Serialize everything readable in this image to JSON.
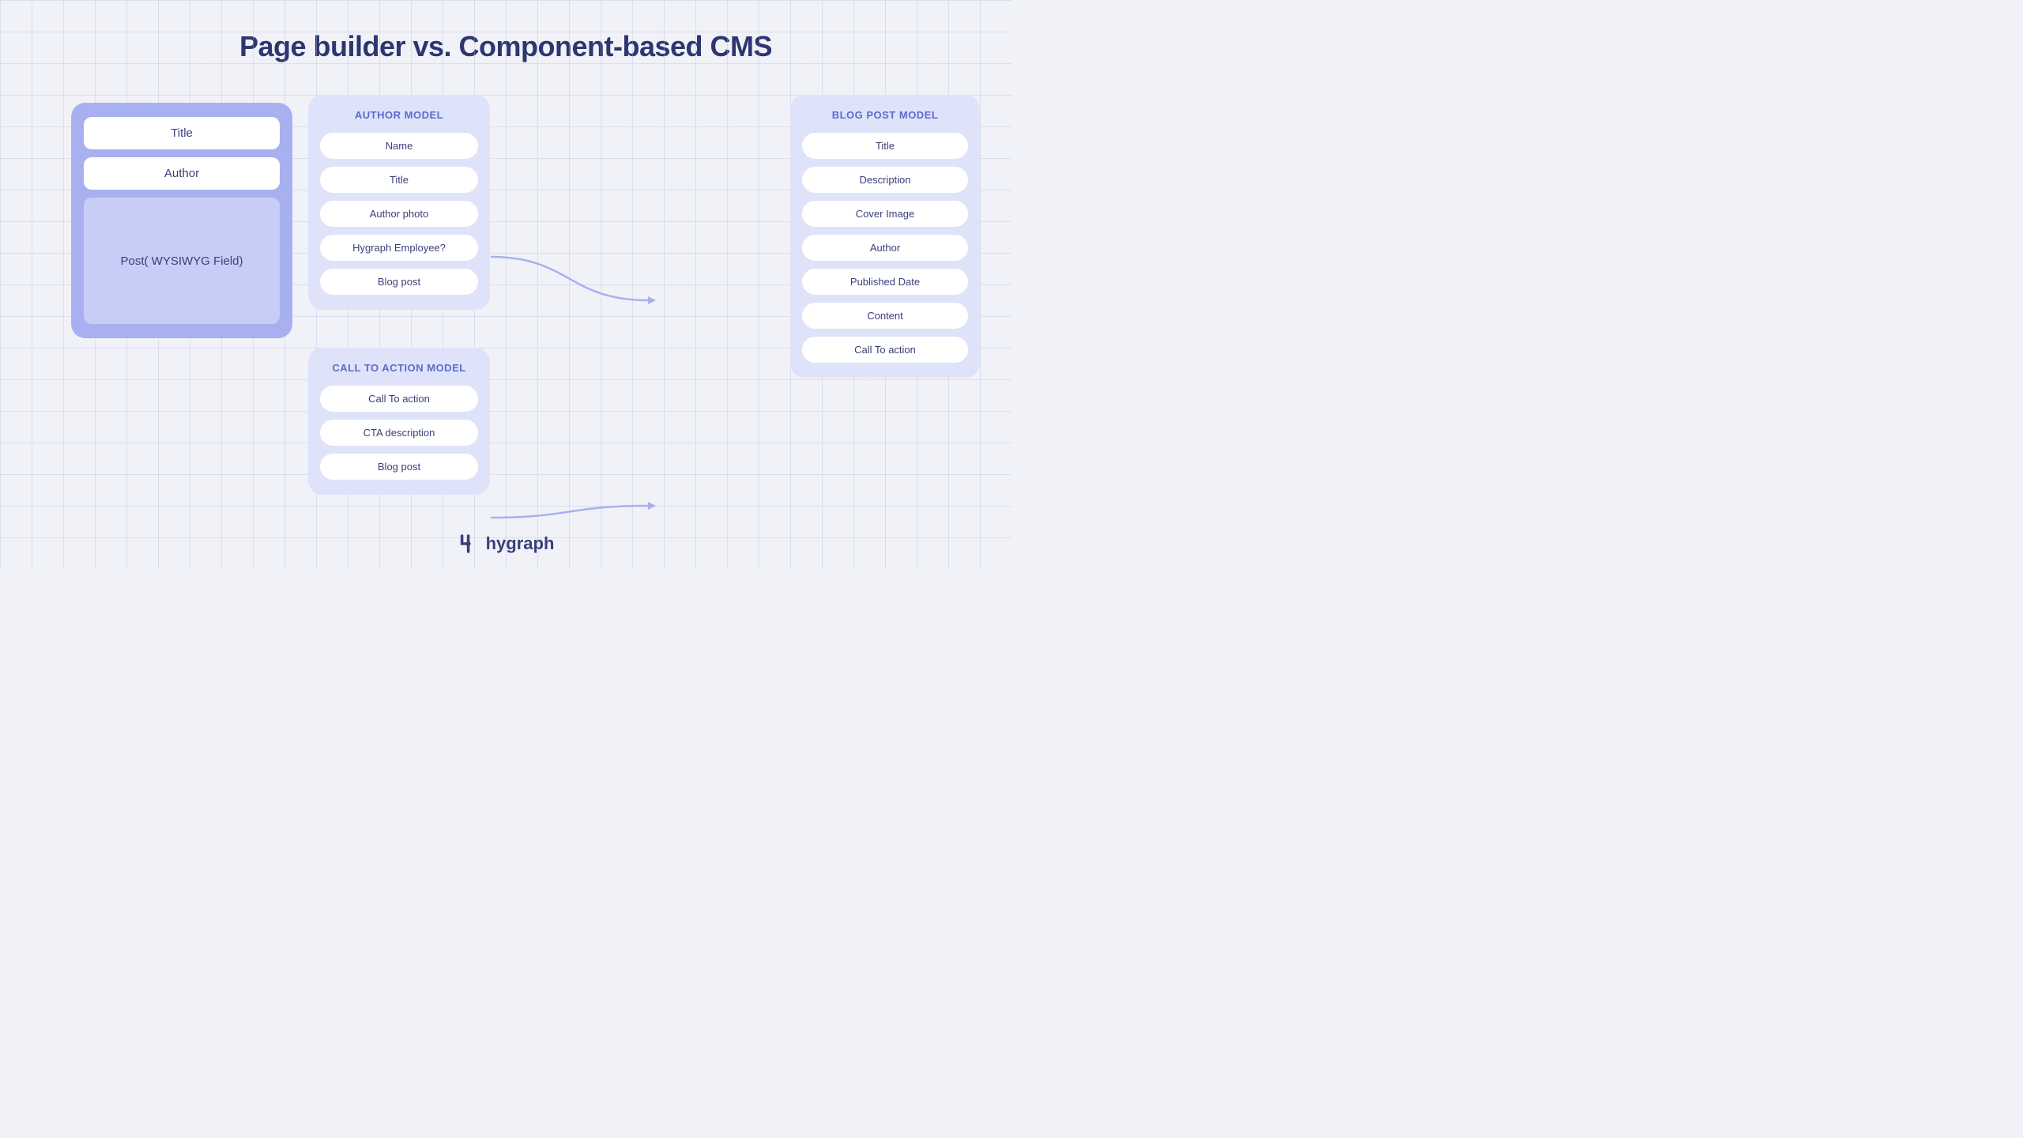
{
  "page": {
    "title": "Page builder vs. Component-based CMS"
  },
  "pageBuilder": {
    "fields": {
      "title": "Title",
      "author": "Author",
      "post": "Post( WYSIWYG Field)"
    }
  },
  "authorModel": {
    "title": "AUTHOR MODEL",
    "fields": [
      "Name",
      "Title",
      "Author photo",
      "Hygraph Employee?",
      "Blog post"
    ]
  },
  "ctaModel": {
    "title": "CALL TO ACTION MODEL",
    "fields": [
      "Call To action",
      "CTA description",
      "Blog post"
    ]
  },
  "blogPostModel": {
    "title": "BLOG POST MODEL",
    "fields": [
      "Title",
      "Description",
      "Cover Image",
      "Author",
      "Published Date",
      "Content",
      "Call To action"
    ]
  },
  "footer": {
    "logo_text": "hygraph"
  }
}
